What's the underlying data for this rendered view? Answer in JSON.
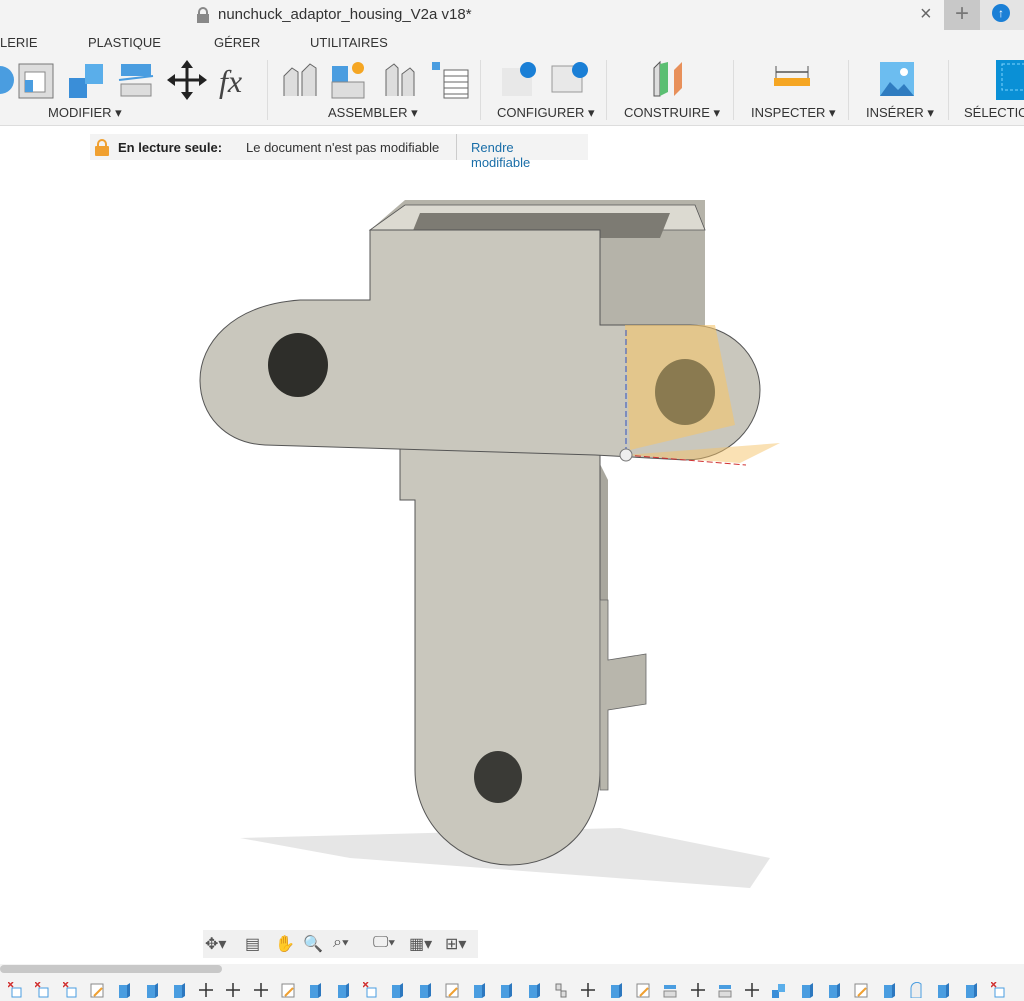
{
  "window": {
    "title": "nunchuck_adaptor_housing_V2a v18*",
    "close": "×",
    "new_tab": "+",
    "update": "↑"
  },
  "ribbon": {
    "tabs": [
      "LERIE",
      "PLASTIQUE",
      "GÉRER",
      "UTILITAIRES"
    ],
    "groups": [
      "MODIFIER ▾",
      "ASSEMBLER ▾",
      "CONFIGURER ▾",
      "CONSTRUIRE ▾",
      "INSPECTER ▾",
      "INSÉRER ▾",
      "SÉLECTIO"
    ]
  },
  "banner": {
    "label": "En lecture seule:",
    "message": "Le document n'est pas modifiable",
    "action": "Rendre modifiable"
  },
  "navbar": {
    "items": [
      "✥▾",
      "▤",
      "✋",
      "🔍",
      "⌕▾",
      "🖵▾",
      "▦▾",
      "⊞▾"
    ]
  },
  "timeline": {
    "icons": [
      "sketch-x",
      "sketch-x",
      "sketch-x",
      "sketch-edit",
      "body",
      "body",
      "body",
      "move",
      "move",
      "move",
      "sketch-edit",
      "body",
      "body",
      "sketch-x",
      "body",
      "body",
      "sketch-edit",
      "body",
      "body",
      "body",
      "joint",
      "move",
      "body",
      "sketch-edit",
      "split",
      "move",
      "split",
      "move",
      "combine",
      "body",
      "body",
      "sketch-edit",
      "body",
      "fillet",
      "body",
      "body",
      "sketch-x"
    ]
  },
  "colors": {
    "accent": "#1a7fd6",
    "link": "#1a6ea8",
    "lock": "#f0a030",
    "model": "#c9c7bd",
    "highlight": "#f5c46a"
  }
}
